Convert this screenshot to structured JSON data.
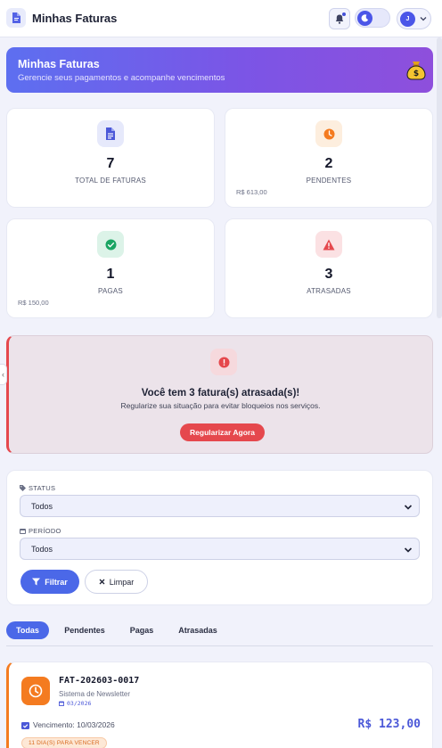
{
  "header": {
    "title": "Minhas Faturas",
    "user_initial": "J"
  },
  "hero": {
    "title": "Minhas Faturas",
    "subtitle": "Gerencie seus pagamentos e acompanhe vencimentos"
  },
  "stats": [
    {
      "value": "7",
      "label": "TOTAL DE FATURAS",
      "sub": "",
      "color": "#4b58d8",
      "icon": "document-icon"
    },
    {
      "value": "2",
      "label": "PENDENTES",
      "sub": "R$ 613,00",
      "color": "#f47b20",
      "icon": "clock-icon"
    },
    {
      "value": "1",
      "label": "PAGAS",
      "sub": "R$ 150,00",
      "color": "#1aa563",
      "icon": "check-circle-icon"
    },
    {
      "value": "3",
      "label": "ATRASADAS",
      "sub": "",
      "color": "#e5484d",
      "icon": "warning-icon"
    }
  ],
  "alert": {
    "title": "Você tem 3 fatura(s) atrasada(s)!",
    "message": "Regularize sua situação para evitar bloqueios nos serviços.",
    "button": "Regularizar Agora"
  },
  "filters": {
    "status_label": "STATUS",
    "status_value": "Todos",
    "period_label": "PERÍODO",
    "period_value": "Todos",
    "filter_button": "Filtrar",
    "clear_button": "Limpar"
  },
  "tabs": [
    {
      "label": "Todas",
      "active": true
    },
    {
      "label": "Pendentes",
      "active": false
    },
    {
      "label": "Pagas",
      "active": false
    },
    {
      "label": "Atrasadas",
      "active": false
    }
  ],
  "invoice": {
    "number": "FAT-202603-0017",
    "service": "Sistema de Newsletter",
    "period": "03/2026",
    "due": "Vencimento: 10/03/2026",
    "amount": "R$ 123,00",
    "badge": "11 DIA(S) PARA VENCER",
    "accent": "#f47b20"
  }
}
